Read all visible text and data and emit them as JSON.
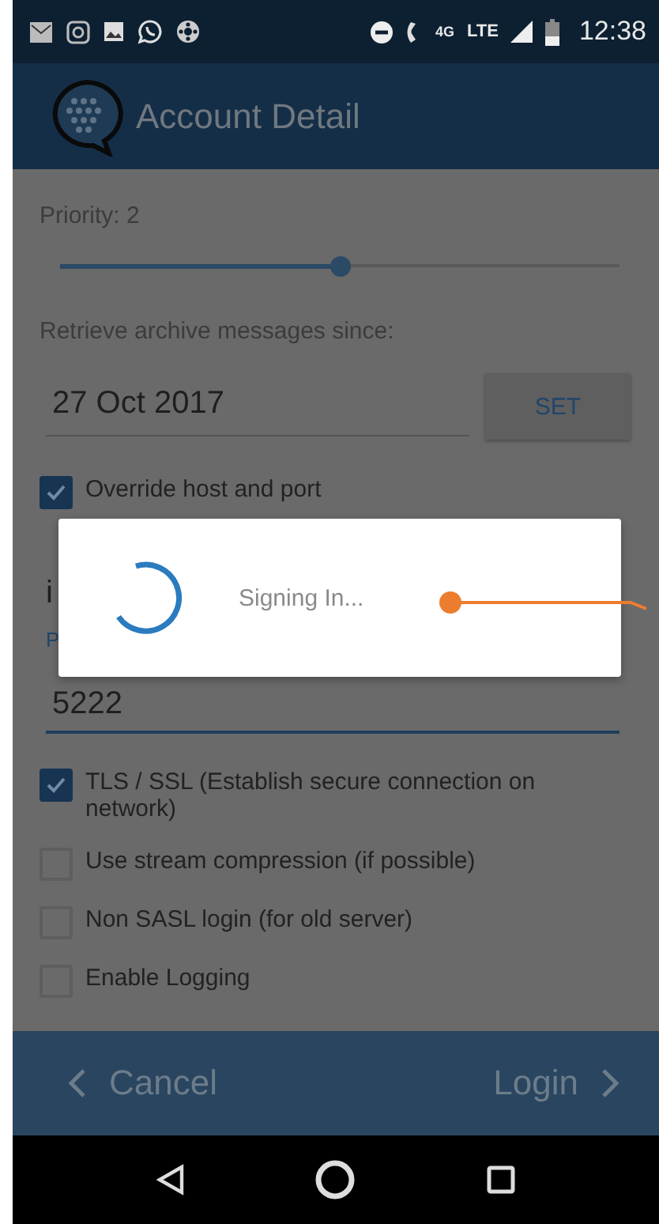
{
  "status_bar": {
    "network_label": "4G",
    "network_type": "LTE",
    "time": "12:38"
  },
  "app_bar": {
    "title": "Account Detail"
  },
  "priority": {
    "label": "Priority: 2",
    "level": 0.5
  },
  "archive": {
    "label": "Retrieve archive messages since:",
    "date": "27 Oct 2017",
    "button": "SET"
  },
  "override": {
    "label": "Override host and port",
    "checked": true
  },
  "host_field": {
    "value": "i"
  },
  "port_field": {
    "label": "P",
    "value": "5222"
  },
  "options": [
    {
      "label": "TLS / SSL (Establish secure connection on network)",
      "checked": true
    },
    {
      "label": "Use stream compression (if possible)",
      "checked": false
    },
    {
      "label": "Non SASL login (for old server)",
      "checked": false
    },
    {
      "label": "Enable Logging",
      "checked": false
    }
  ],
  "dialog": {
    "message": "Signing In..."
  },
  "bottom_bar": {
    "cancel": "Cancel",
    "login": "Login"
  }
}
